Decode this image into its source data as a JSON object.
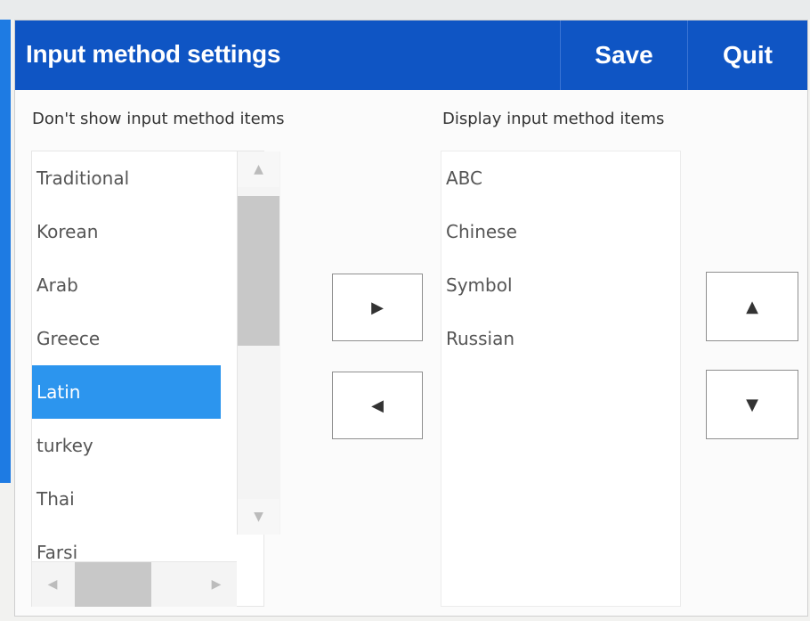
{
  "window": {
    "title": "Input method settings",
    "save_label": "Save",
    "quit_label": "Quit",
    "title_bar_color": "#0f55c4"
  },
  "hidden_panel": {
    "label": "Don't show input method items",
    "items": [
      {
        "label": "Traditional",
        "selected": false
      },
      {
        "label": "Korean",
        "selected": false
      },
      {
        "label": "Arab",
        "selected": false
      },
      {
        "label": "Greece",
        "selected": false
      },
      {
        "label": "Latin",
        "selected": true
      },
      {
        "label": "turkey",
        "selected": false
      },
      {
        "label": "Thai",
        "selected": false
      },
      {
        "label": "Farsi",
        "selected": false
      }
    ],
    "selected_color": "#2c95ee"
  },
  "shown_panel": {
    "label": "Display input method items",
    "items": [
      {
        "label": "ABC"
      },
      {
        "label": "Chinese"
      },
      {
        "label": "Symbol"
      },
      {
        "label": "Russian"
      }
    ]
  },
  "icons": {
    "move_right": "triangle-right-icon",
    "move_left": "triangle-left-icon",
    "move_up": "triangle-up-icon",
    "move_down": "triangle-down-icon"
  }
}
